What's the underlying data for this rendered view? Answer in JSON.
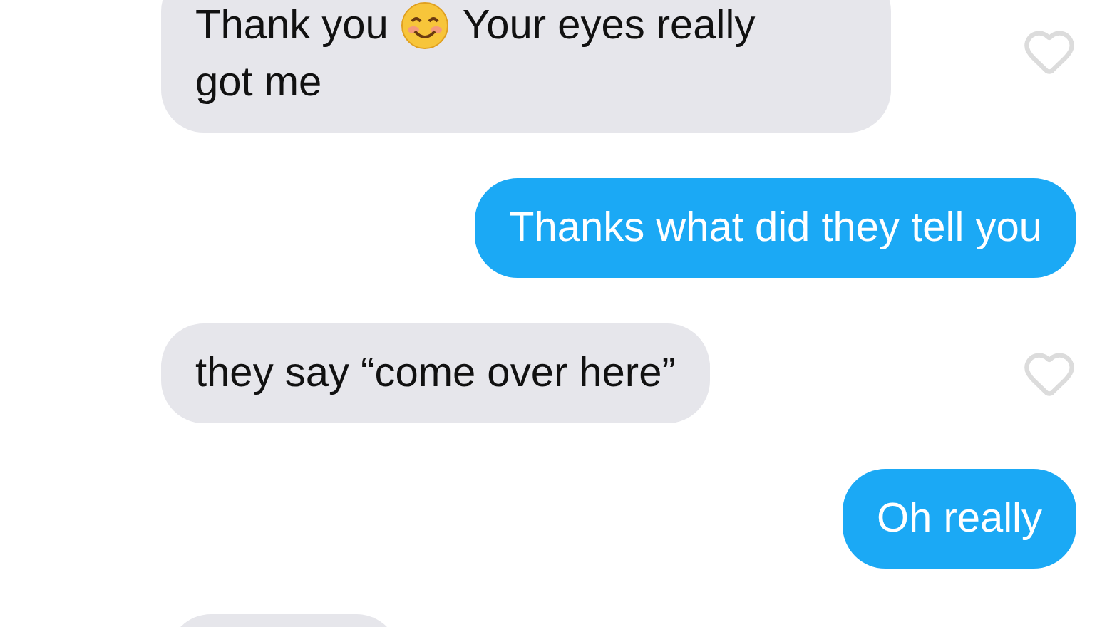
{
  "messages": [
    {
      "kind": "received",
      "liked": false,
      "parts": [
        {
          "kind": "text",
          "text": "Thank you"
        },
        {
          "kind": "emoji"
        },
        {
          "kind": "text",
          "text": "Your eyes really"
        },
        {
          "kind": "text",
          "text": "got me"
        }
      ]
    },
    {
      "kind": "sent",
      "text": "Thanks what did they tell you"
    },
    {
      "kind": "received",
      "liked": false,
      "text": "they say “come over here”"
    },
    {
      "kind": "sent",
      "text": "Oh really"
    },
    {
      "kind": "received"
    }
  ]
}
